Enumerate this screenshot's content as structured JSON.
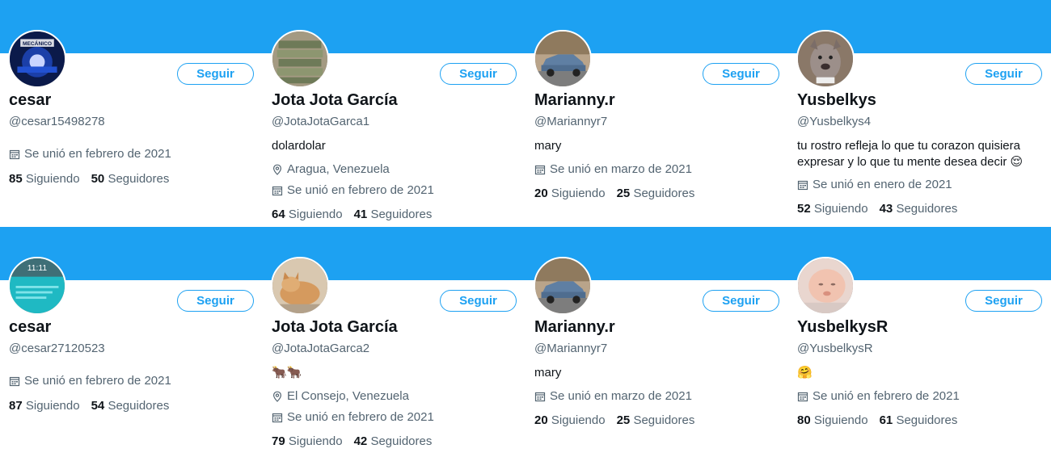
{
  "colors": {
    "banner": "#1da1f2",
    "accent": "#1da1f2",
    "text": "#0f1419",
    "muted": "#536471"
  },
  "follow_label": "Seguir",
  "cards": [
    {
      "name": "cesar",
      "handle": "@cesar15498278",
      "bio": "",
      "location": "",
      "joined": "Se unió en febrero de 2021",
      "following_count": "85",
      "following_label": "Siguiendo",
      "followers_count": "50",
      "followers_label": "Seguidores",
      "avatar_icon": "motor-mechanic-logo-avatar",
      "avatar_text": "MECÁNICO"
    },
    {
      "name": "Jota Jota García",
      "handle": "@JotaJotaGarca1",
      "bio": "dolardolar",
      "location": "Aragua, Venezuela",
      "joined": "Se unió en febrero de 2021",
      "following_count": "64",
      "following_label": "Siguiendo",
      "followers_count": "41",
      "followers_label": "Seguidores",
      "avatar_icon": "dollar-bills-avatar"
    },
    {
      "name": "Marianny.r",
      "handle": "@Mariannyr7",
      "bio": "mary",
      "location": "",
      "joined": "Se unió en marzo de 2021",
      "following_count": "20",
      "following_label": "Siguiendo",
      "followers_count": "25",
      "followers_label": "Seguidores",
      "avatar_icon": "blue-car-avatar"
    },
    {
      "name": "Yusbelkys",
      "handle": "@Yusbelkys4",
      "bio": "tu rostro refleja lo que tu corazon quisiera expresar y lo que tu mente desea decir 😌",
      "location": "",
      "joined": "Se unió en enero de 2021",
      "following_count": "52",
      "following_label": "Siguiendo",
      "followers_count": "43",
      "followers_label": "Seguidores",
      "avatar_icon": "dog-avatar"
    },
    {
      "name": "cesar",
      "handle": "@cesar27120523",
      "bio": "",
      "location": "",
      "joined": "Se unió en febrero de 2021",
      "following_count": "87",
      "following_label": "Siguiendo",
      "followers_count": "54",
      "followers_label": "Seguidores",
      "avatar_icon": "phone-lockscreen-avatar",
      "avatar_text": "11:11"
    },
    {
      "name": "Jota Jota García",
      "handle": "@JotaJotaGarca2",
      "bio": "🐂🐂",
      "location": "El Consejo, Venezuela",
      "joined": "Se unió en febrero de 2021",
      "following_count": "79",
      "following_label": "Siguiendo",
      "followers_count": "42",
      "followers_label": "Seguidores",
      "avatar_icon": "cat-avatar"
    },
    {
      "name": "Marianny.r",
      "handle": "@Mariannyr7",
      "bio": "mary",
      "location": "",
      "joined": "Se unió en marzo de 2021",
      "following_count": "20",
      "following_label": "Siguiendo",
      "followers_count": "25",
      "followers_label": "Seguidores",
      "avatar_icon": "blue-car-avatar"
    },
    {
      "name": "YusbelkysR",
      "handle": "@YusbelkysR",
      "bio": "🤗",
      "location": "",
      "joined": "Se unió en febrero de 2021",
      "following_count": "80",
      "following_label": "Siguiendo",
      "followers_count": "61",
      "followers_label": "Seguidores",
      "avatar_icon": "baby-avatar"
    }
  ]
}
